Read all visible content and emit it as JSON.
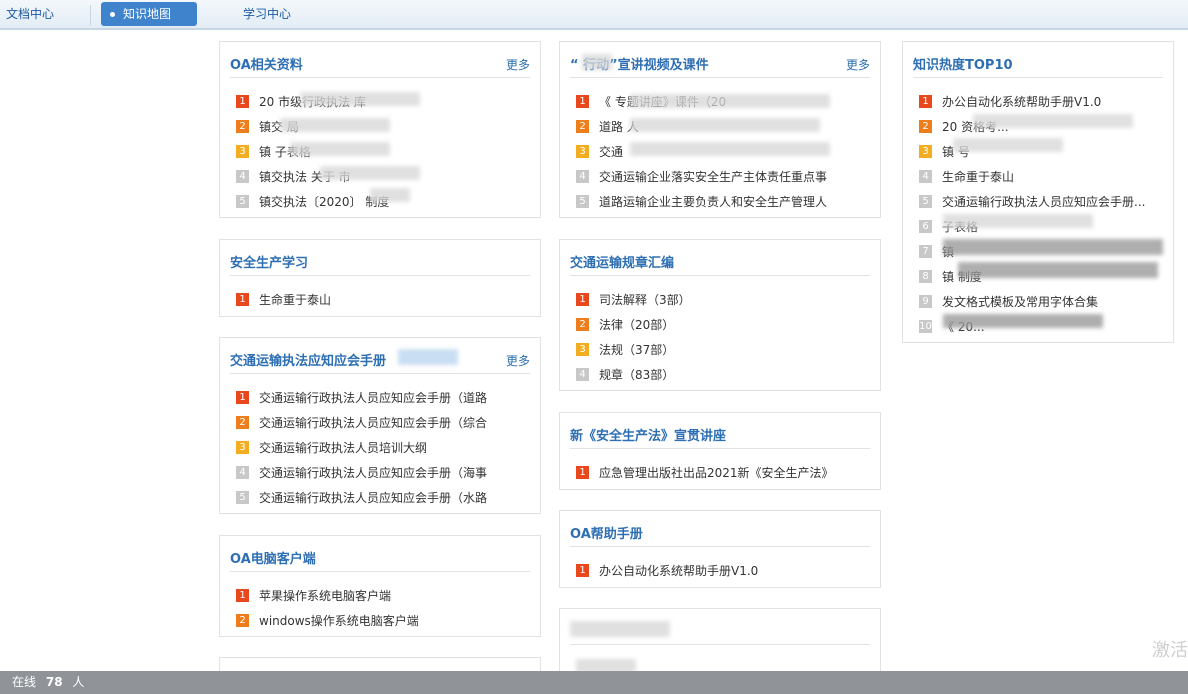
{
  "nav": {
    "tabs": [
      {
        "label": "文档中心"
      },
      {
        "label": "知识地图"
      },
      {
        "label": "学习中心"
      }
    ]
  },
  "cards": {
    "oa_docs": {
      "title": "OA相关资料",
      "more": "更多",
      "items": [
        {
          "num": "1",
          "label": "20 市级行政执法 库"
        },
        {
          "num": "2",
          "label": "镇交 局"
        },
        {
          "num": "3",
          "label": "镇 子表格"
        },
        {
          "num": "4",
          "label": "镇交执法 关于 市"
        },
        {
          "num": "5",
          "label": "镇交执法〔2020〕 制度"
        }
      ]
    },
    "action_videos": {
      "title": "“ 行动”宣讲视频及课件",
      "more": "更多",
      "items": [
        {
          "num": "1",
          "label": "《 专题讲座》课件（20"
        },
        {
          "num": "2",
          "label": "道路 人"
        },
        {
          "num": "3",
          "label": "交通 "
        },
        {
          "num": "4",
          "label": "交通运输企业落实安全生产主体责任重点事"
        },
        {
          "num": "5",
          "label": "道路运输企业主要负责人和安全生产管理人"
        }
      ]
    },
    "top10": {
      "title": "知识热度TOP10",
      "items": [
        {
          "num": "1",
          "label": "办公自动化系统帮助手册V1.0"
        },
        {
          "num": "2",
          "label": "20 资格考..."
        },
        {
          "num": "3",
          "label": "镇 号"
        },
        {
          "num": "4",
          "label": "生命重于泰山"
        },
        {
          "num": "5",
          "label": "交通运输行政执法人员应知应会手册..."
        },
        {
          "num": "6",
          "label": "子表格"
        },
        {
          "num": "7",
          "label": "镇"
        },
        {
          "num": "8",
          "label": "镇 制度"
        },
        {
          "num": "9",
          "label": "发文格式模板及常用字体合集"
        },
        {
          "num": "10",
          "label": "《 20..."
        }
      ]
    },
    "safety": {
      "title": "安全生产学习",
      "items": [
        {
          "num": "1",
          "label": "生命重于泰山"
        }
      ]
    },
    "regulations": {
      "title": "交通运输规章汇编",
      "items": [
        {
          "num": "1",
          "label": "司法解释（3部）"
        },
        {
          "num": "2",
          "label": "法律（20部）"
        },
        {
          "num": "3",
          "label": "法规（37部）"
        },
        {
          "num": "4",
          "label": "规章（83部）"
        }
      ]
    },
    "handbook": {
      "title": "交通运输执法应知应会手册",
      "more": "更多",
      "items": [
        {
          "num": "1",
          "label": "交通运输行政执法人员应知应会手册（道路"
        },
        {
          "num": "2",
          "label": "交通运输行政执法人员应知应会手册（综合"
        },
        {
          "num": "3",
          "label": "交通运输行政执法人员培训大纲"
        },
        {
          "num": "4",
          "label": "交通运输行政执法人员应知应会手册（海事"
        },
        {
          "num": "5",
          "label": "交通运输行政执法人员应知应会手册（水路"
        }
      ]
    },
    "safety_law": {
      "title": "新《安全生产法》宣贯讲座",
      "items": [
        {
          "num": "1",
          "label": "应急管理出版社出品2021新《安全生产法》"
        }
      ]
    },
    "oa_help": {
      "title": "OA帮助手册",
      "items": [
        {
          "num": "1",
          "label": "办公自动化系统帮助手册V1.0"
        }
      ]
    },
    "oa_client": {
      "title": "OA电脑客户端",
      "items": [
        {
          "num": "1",
          "label": "苹果操作系统电脑客户端"
        },
        {
          "num": "2",
          "label": "windows操作系统电脑客户端"
        }
      ]
    }
  },
  "footer": {
    "prefix": "在线",
    "count": "78",
    "suffix": "人"
  },
  "watermark": "激活"
}
